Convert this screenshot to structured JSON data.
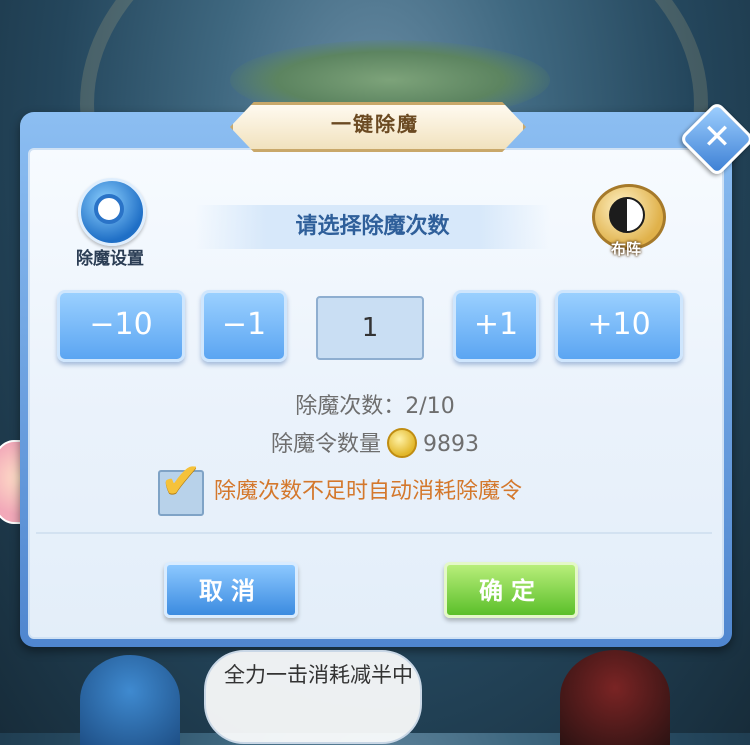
{
  "dialog": {
    "title": "一键除魔",
    "subtitle": "请选择除魔次数",
    "settings_label": "除魔设置",
    "formation_label": "布阵",
    "buttons": {
      "minus10": "−10",
      "minus1": "−1",
      "plus1": "+1",
      "plus10": "+10",
      "cancel": "取消",
      "confirm": "确定"
    },
    "count_value": "1",
    "count_line_label": "除魔次数：",
    "count_line_value": "2/10",
    "token_label": "除魔令数量",
    "token_value": "9893",
    "auto_consume_label": "除魔次数不足时自动消耗除魔令",
    "auto_consume_checked": true
  },
  "scene": {
    "speech_text": "全力一击消耗减半中"
  },
  "colors": {
    "button_blue": "#5ba5f2",
    "confirm_green": "#5bbf2a",
    "warning_orange": "#d4782c",
    "title_brown": "#6b4a22"
  },
  "icons": {
    "settings": "gear-icon",
    "formation": "taiji-icon",
    "token": "token-coin-icon",
    "close": "close-icon",
    "check": "checkmark-icon"
  }
}
